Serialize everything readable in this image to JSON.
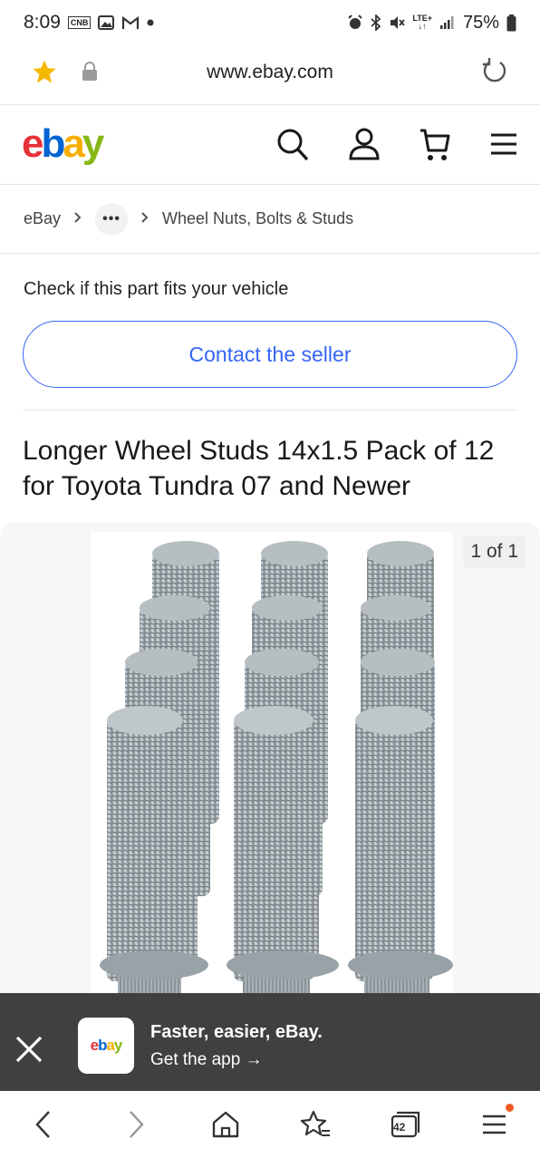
{
  "status_bar": {
    "time": "8:09",
    "notif_badge": "CNB",
    "battery": "75%",
    "network": "LTE+"
  },
  "browser": {
    "url": "www.ebay.com",
    "tab_count": "42"
  },
  "header": {
    "logo_letters": [
      "e",
      "b",
      "a",
      "y"
    ],
    "brand_colors": {
      "e": "#e53238",
      "b": "#0064d2",
      "a": "#f5af02",
      "y": "#86b817"
    }
  },
  "breadcrumb": {
    "root": "eBay",
    "more": "•••",
    "category": "Wheel Nuts, Bolts & Studs"
  },
  "fitment": {
    "prompt": "Check if this part fits your vehicle",
    "button_label": "Contact the seller"
  },
  "item": {
    "title": "Longer Wheel Studs 14x1.5 Pack of 12 for Toyota Tundra 07 and Newer"
  },
  "gallery": {
    "counter": "1 of 1"
  },
  "app_banner": {
    "logo_text": "ebay",
    "title": "Faster, easier, eBay.",
    "cta": "Get the app →"
  },
  "colors": {
    "accent_blue": "#3665f3",
    "banner_bg": "#404040",
    "notification_dot": "#f25c22"
  }
}
